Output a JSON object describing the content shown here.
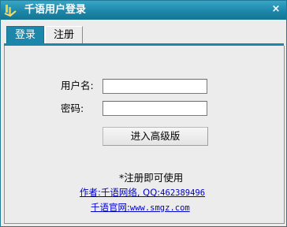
{
  "window": {
    "title": "千语用户登录",
    "close_glyph": "×",
    "accent_color": "#1c87aa"
  },
  "tabs": [
    {
      "label": "登录",
      "active": true
    },
    {
      "label": "注册",
      "active": false
    }
  ],
  "login": {
    "username_label": "用户名:",
    "username_value": "",
    "password_label": "密码:",
    "password_value": "",
    "enter_button": "进入高级版"
  },
  "footer": {
    "note": "*注册即可使用",
    "author_link_prefix": "作者:千语网络, QQ:",
    "author_link_qq": "462389496",
    "site_link_prefix": "千语官网:",
    "site_link_url": "www.smgz.com"
  },
  "icons": {
    "app": "app-icon",
    "close": "close-icon"
  }
}
